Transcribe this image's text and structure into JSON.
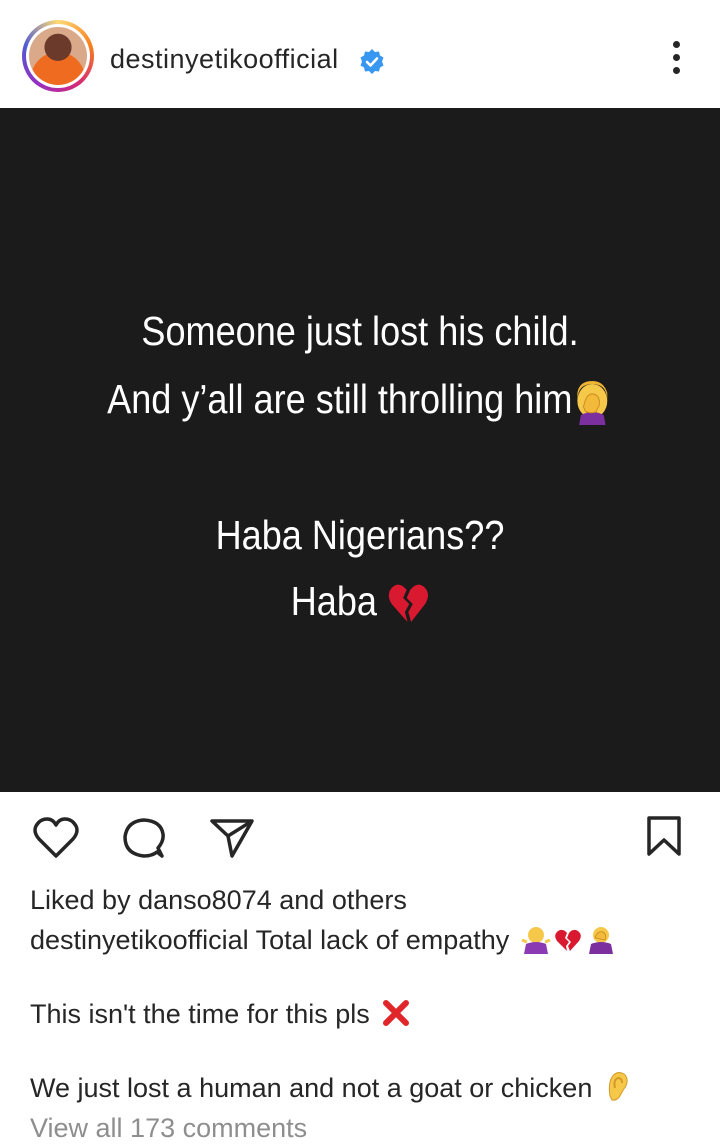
{
  "header": {
    "username": "destinyetikoofficial",
    "verified": true
  },
  "post": {
    "background": "#1b1b1b",
    "lines": [
      "Someone just lost his child.",
      "And y’all are still throlling him",
      "Haba Nigerians??",
      "Haba"
    ],
    "line2_emoji": "face-palm-emoji",
    "line4_emoji": "broken-heart-emoji"
  },
  "actions": {
    "like_icon": "heart-icon",
    "comment_icon": "comment-icon",
    "share_icon": "send-icon",
    "save_icon": "bookmark-icon"
  },
  "likes": {
    "prefix": "Liked by",
    "user": "danso8074",
    "middle": "and",
    "suffix": "others"
  },
  "caption": {
    "username": "destinyetikoofficial",
    "line1": "Total lack of empathy",
    "line2": "This isn't the time for this pls",
    "line3": "We just lost a human and not a goat or chicken"
  },
  "comments_link": "View all 173 comments",
  "colors": {
    "verified_blue": "#3897f0",
    "broken_heart": "#d9192f",
    "cross_red": "#e0262b"
  }
}
